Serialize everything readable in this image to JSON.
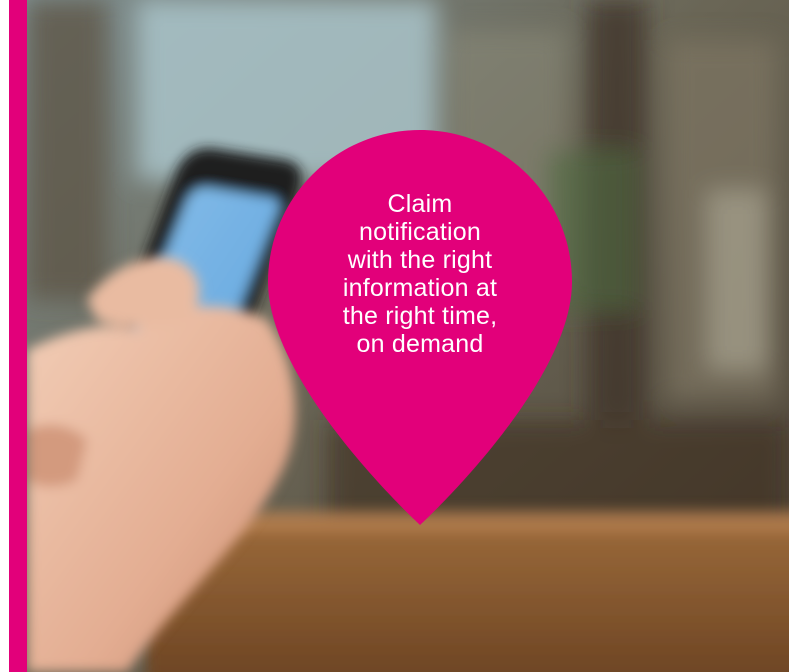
{
  "colors": {
    "accent": "#e2007a",
    "text_on_accent": "#ffffff"
  },
  "image": {
    "subject": "hand-holding-smartphone-photo"
  },
  "callout": {
    "lines": [
      "Claim",
      "notification",
      "with the right",
      "information at",
      "the right time,",
      "on demand"
    ]
  }
}
